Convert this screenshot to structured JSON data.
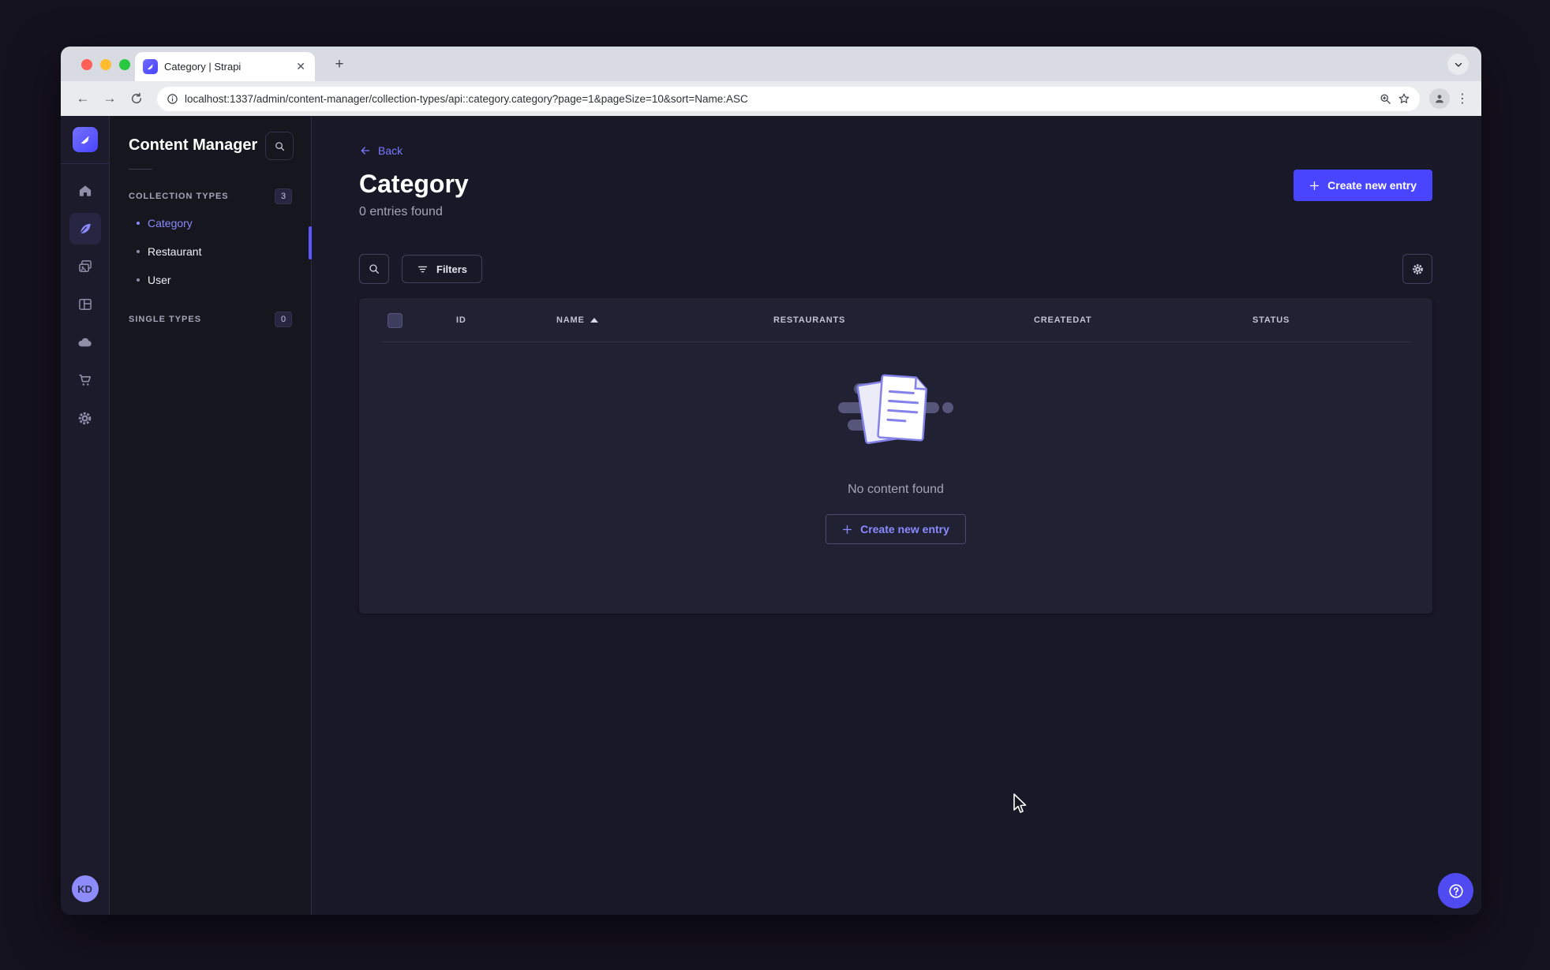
{
  "browser": {
    "tab": {
      "title": "Category | Strapi",
      "close_glyph": "✕",
      "new_tab_glyph": "+"
    },
    "toolbar": {
      "back_glyph": "←",
      "forward_glyph": "→",
      "url": "localhost:1337/admin/content-manager/collection-types/api::category.category?page=1&pageSize=10&sort=Name:ASC"
    }
  },
  "rail": {
    "items": [
      {
        "name": "home"
      },
      {
        "name": "content-manager",
        "active": true
      },
      {
        "name": "media-library"
      },
      {
        "name": "content-type-builder"
      },
      {
        "name": "cloud"
      },
      {
        "name": "marketplace"
      },
      {
        "name": "settings"
      }
    ],
    "avatar_initials": "KD"
  },
  "subnav": {
    "title": "Content Manager",
    "sections": [
      {
        "label": "COLLECTION TYPES",
        "badge": "3",
        "items": [
          {
            "label": "Category",
            "active": true
          },
          {
            "label": "Restaurant"
          },
          {
            "label": "User"
          }
        ]
      },
      {
        "label": "SINGLE TYPES",
        "badge": "0",
        "items": []
      }
    ]
  },
  "main": {
    "back_label": "Back",
    "title": "Category",
    "subtitle": "0 entries found",
    "create_button_label": "Create new entry",
    "filters_button_label": "Filters",
    "table": {
      "columns": [
        "ID",
        "NAME",
        "RESTAURANTS",
        "CREATEDAT",
        "STATUS"
      ],
      "sorted_column": "NAME",
      "sort_direction": "ASC"
    },
    "empty_state": {
      "message": "No content found",
      "cta_label": "Create new entry"
    }
  },
  "colors": {
    "primary": "#4945ff",
    "link": "#7b79ff",
    "app_background": "#181826",
    "card_background": "#212134",
    "border": "#32324d"
  }
}
